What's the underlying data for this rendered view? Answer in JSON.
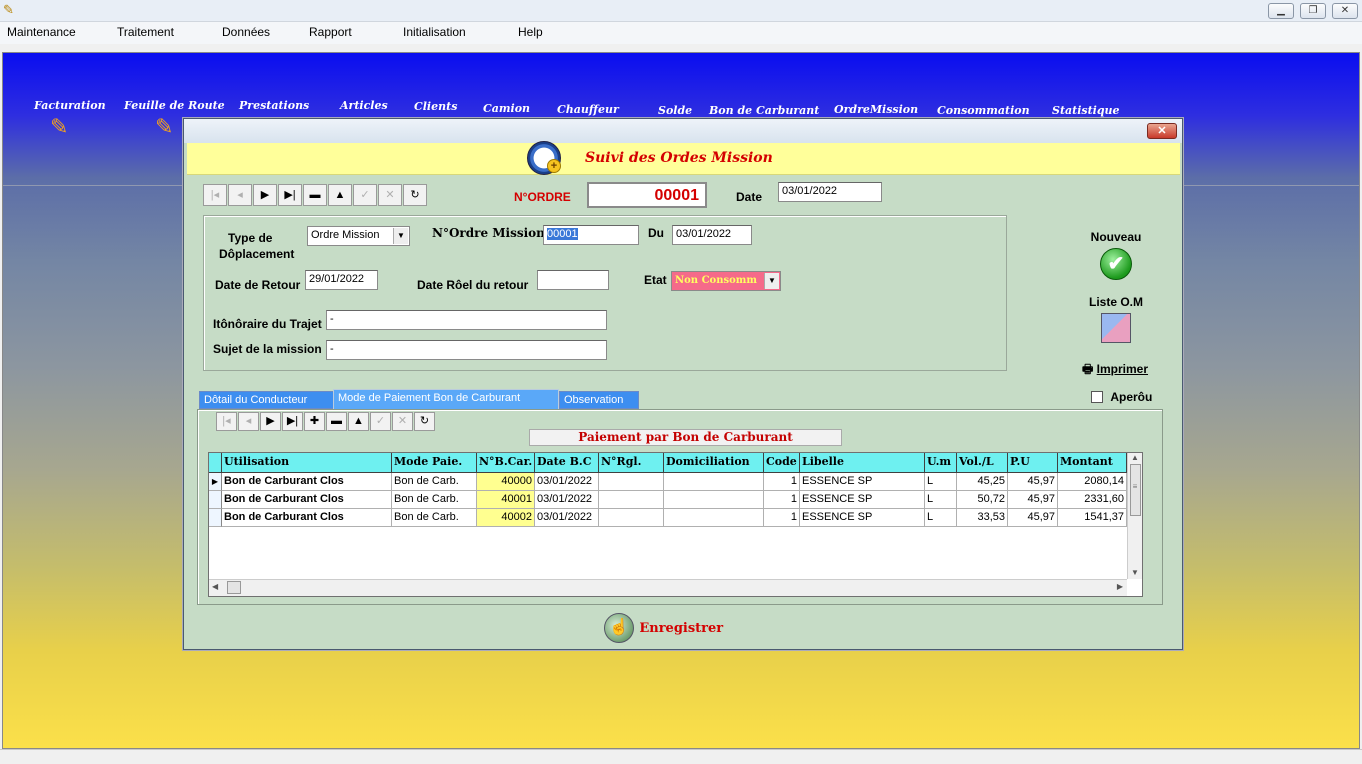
{
  "menu": [
    "Maintenance",
    "Traitement",
    "Données",
    "Rapport",
    "Initialisation",
    "Help"
  ],
  "nav": [
    {
      "label": "Facturation",
      "icon": "pencil-grid-icon"
    },
    {
      "label": "Feuille de Route",
      "icon": "pencil-grid-icon"
    },
    {
      "label": "Prestations"
    },
    {
      "label": "Articles"
    },
    {
      "label": "Clients"
    },
    {
      "label": "Camion"
    },
    {
      "label": "Chauffeur"
    },
    {
      "label": "Solde"
    },
    {
      "label": "Bon de Carburant"
    },
    {
      "label": "OrdreMission"
    },
    {
      "label": "Consommation"
    },
    {
      "label": "Statistique"
    }
  ],
  "dialog": {
    "title": "Suivi des Ordes Mission",
    "close": "✕",
    "nordre_label": "N°ORDRE",
    "nordre_value": "00001",
    "date_label": "Date",
    "date_value": "03/01/2022",
    "type_label_1": "Type de",
    "type_label_2": "Dôplacement",
    "type_value": "Ordre Mission",
    "nordre_mission_label": "N°Ordre Mission",
    "nordre_mission_value": "00001",
    "du_label": "Du",
    "du_value": "03/01/2022",
    "date_retour_label": "Date de Retour",
    "date_retour_value": "29/01/2022",
    "date_reel_label": "Date Rôel du retour",
    "date_reel_value": "",
    "etat_label": "Etat",
    "etat_value": "Non Consomm",
    "itineraire_label": "Itônôraire du Trajet",
    "itineraire_value": "-",
    "sujet_label": "Sujet de la mission",
    "sujet_value": "-",
    "nouveau_label": "Nouveau",
    "liste_label": "Liste O.M",
    "imprimer_label": "Imprimer",
    "apercu_label": "Aperôu",
    "save_label": "Enregistrer"
  },
  "tabs": [
    "Dôtail du Conducteur",
    "Mode de Paiement Bon de Carburant",
    "Observation"
  ],
  "panel_title": "Paiement par Bon de Carburant",
  "grid": {
    "headers": [
      "Utilisation",
      "Mode Paie.",
      "N°B.Car.",
      "Date B.C",
      "N°Rgl.",
      "Domiciliation",
      "Code",
      "Libelle",
      "U.m",
      "Vol./L",
      "P.U",
      "Montant"
    ],
    "rows": [
      [
        "Bon de Carburant Clos",
        "Bon de Carb.",
        "40000",
        "03/01/2022",
        "",
        "",
        "1",
        "ESSENCE SP",
        "L",
        "45,25",
        "45,97",
        "2080,14"
      ],
      [
        "Bon de Carburant Clos",
        "Bon de Carb.",
        "40001",
        "03/01/2022",
        "",
        "",
        "1",
        "ESSENCE SP",
        "L",
        "50,72",
        "45,97",
        "2331,60"
      ],
      [
        "Bon de Carburant Clos",
        "Bon de Carb.",
        "40002",
        "03/01/2022",
        "",
        "",
        "1",
        "ESSENCE SP",
        "L",
        "33,53",
        "45,97",
        "1541,37"
      ]
    ]
  },
  "colors": {
    "title_red": "#d40000",
    "grid_header": "#6ef0f0",
    "tab_blue": "#3d8ef0",
    "dialog_bg": "#c6dcc6",
    "yellow": "#ffff9a"
  }
}
